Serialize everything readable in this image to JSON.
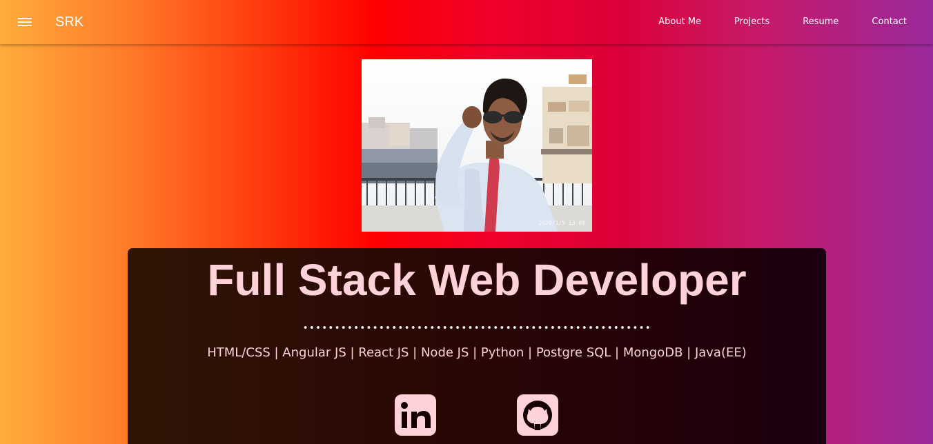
{
  "navbar": {
    "brand": "SRK",
    "menu_icon": "hamburger-menu-icon",
    "links": [
      {
        "label": "About Me"
      },
      {
        "label": "Projects"
      },
      {
        "label": "Resume"
      },
      {
        "label": "Contact"
      }
    ]
  },
  "profile": {
    "photo_stamp": "2020/1/5  13:08"
  },
  "hero": {
    "title": "Full Stack Web Developer",
    "skills": "HTML/CSS | Angular JS | React JS | Node JS | Python | Postgre SQL | MongoDB | Java(EE)",
    "social": [
      {
        "icon": "linkedin-icon"
      },
      {
        "icon": "github-icon"
      }
    ]
  },
  "colors": {
    "card_text": "#ffd2da",
    "card_bg": "#2a0704",
    "nav_text": "#ffffff"
  }
}
